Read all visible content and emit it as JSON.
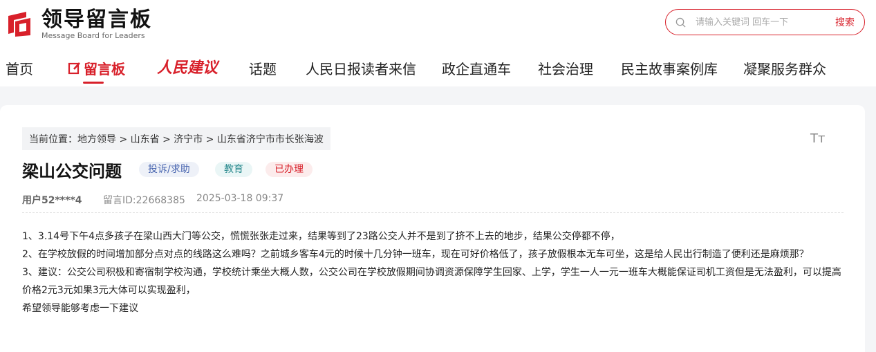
{
  "header": {
    "logo_title": "领导留言板",
    "logo_subtitle": "Message Board for Leaders",
    "search": {
      "placeholder": "请输入关键词 回车一下",
      "button_label": "搜索"
    }
  },
  "nav": {
    "items": [
      {
        "label": "首页"
      },
      {
        "label": "留言板"
      },
      {
        "label": "人民建议"
      },
      {
        "label": "话题"
      },
      {
        "label": "人民日报读者来信"
      },
      {
        "label": "政企直通车"
      },
      {
        "label": "社会治理"
      },
      {
        "label": "民主故事案例库"
      },
      {
        "label": "凝聚服务群众"
      }
    ]
  },
  "breadcrumb": "当前位置：地方领导 > 山东省 > 济宁市 > 山东省济宁市市长张海波",
  "font_size_toggle": "Tт",
  "message": {
    "title": "梁山公交问题",
    "tags": [
      "投诉/求助",
      "教育",
      "已办理"
    ],
    "user": "用户52****4",
    "id": "留言ID:22668385",
    "datetime": "2025-03-18 09:37",
    "paragraphs": [
      "1、3.14号下午4点多孩子在梁山西大门等公交，慌慌张张走过来，结果等到了23路公交人并不是到了挤不上去的地步，结果公交停都不停，",
      "2、在学校放假的时间增加部分点对点的线路这么难吗？之前城乡客车4元的时候十几分钟一班车，现在可好价格低了，孩子放假根本无车可坐，这是给人民出行制造了便利还是麻烦那？",
      "3、建议：公交公司积极和寄宿制学校沟通，学校统计乘坐大概人数，公交公司在学校放假期间协调资源保障学生回家、上学，学生一人一元一班车大概能保证司机工资但是无法盈利，可以提高价格2元3元如果3元大体可以实现盈利，",
      "希望领导能够考虑一下建议"
    ]
  },
  "colors": {
    "brand_red": "#d8202a",
    "page_bg": "#f4f5f7"
  }
}
